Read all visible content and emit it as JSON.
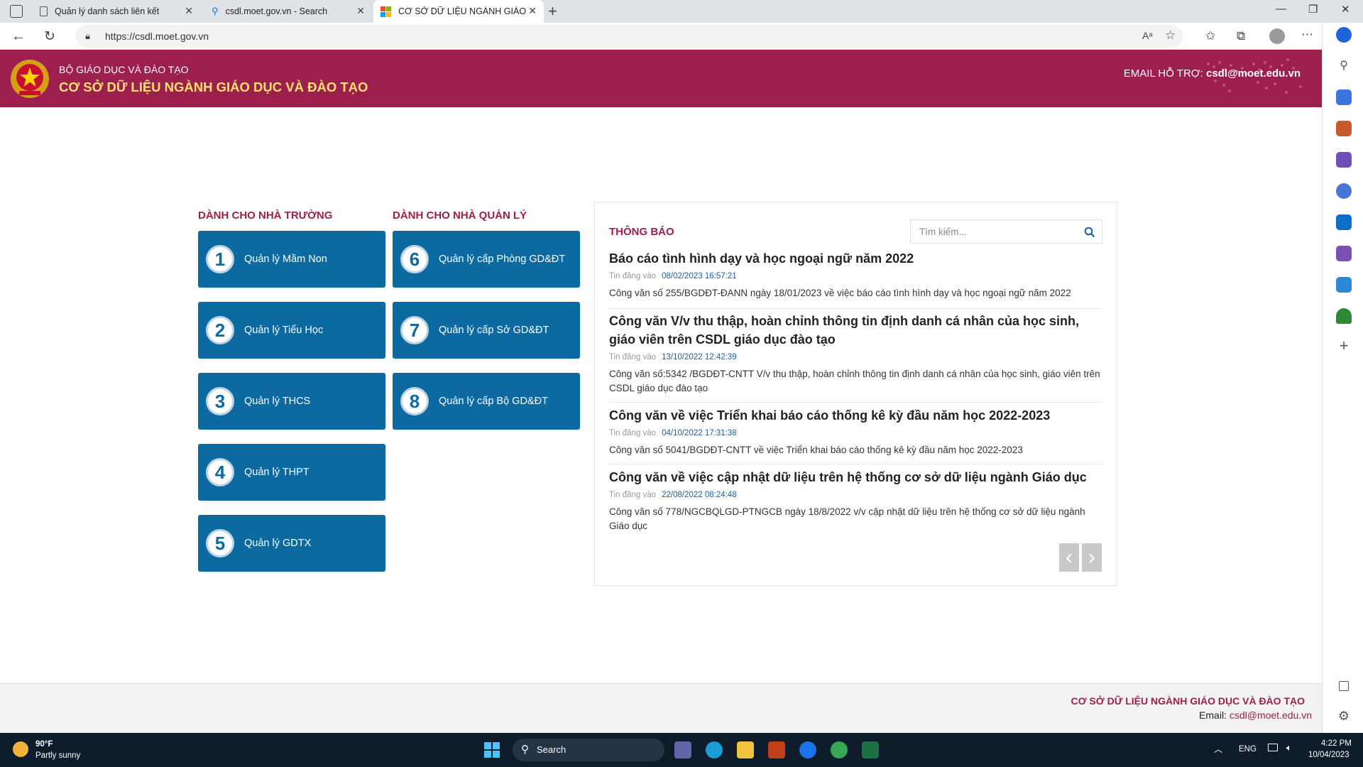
{
  "browser": {
    "tabs": [
      {
        "title": "Quản lý danh sách liên kết"
      },
      {
        "title": "csdl.moet.gov.vn - Search"
      },
      {
        "title": "CƠ SỞ DỮ LIỆU NGÀNH GIÁO DỤ"
      }
    ],
    "url": "https://csdl.moet.gov.vn"
  },
  "header": {
    "org": "BỘ GIÁO DỤC VÀ ĐÀO TẠO",
    "site_title": "CƠ SỞ DỮ LIỆU NGÀNH GIÁO DỤC VÀ ĐÀO TẠO",
    "email_label": "EMAIL HỖ TRỢ:",
    "email_value": "csdl@moet.edu.vn"
  },
  "schools": {
    "heading": "DÀNH CHO NHÀ TRƯỜNG",
    "items": [
      {
        "num": "1",
        "label": "Quản lý Mầm Non"
      },
      {
        "num": "2",
        "label": "Quản lý Tiểu Học"
      },
      {
        "num": "3",
        "label": "Quản lý THCS"
      },
      {
        "num": "4",
        "label": "Quản lý THPT"
      },
      {
        "num": "5",
        "label": "Quản lý GDTX"
      }
    ]
  },
  "managers": {
    "heading": "DÀNH CHO NHÀ QUẢN LÝ",
    "items": [
      {
        "num": "6",
        "label": "Quản lý cấp Phòng GD&ĐT"
      },
      {
        "num": "7",
        "label": "Quản lý cấp Sở GD&ĐT"
      },
      {
        "num": "8",
        "label": "Quản lý cấp Bộ GD&ĐT"
      }
    ]
  },
  "notices": {
    "heading": "THÔNG BÁO",
    "search_placeholder": "Tìm kiếm...",
    "posted_label": "Tin đăng vào",
    "items": [
      {
        "title": "Báo cáo tình hình dạy và học ngoại ngữ năm 2022",
        "date": "08/02/2023 16:57:21",
        "desc": "Công văn số 255/BGDĐT-ĐANN ngày 18/01/2023 về việc báo cáo tình hình dạy và học ngoại ngữ năm 2022"
      },
      {
        "title": "Công văn V/v thu thập, hoàn chỉnh thông tin định danh cá nhân của học sinh, giáo viên trên CSDL giáo dục đào tạo",
        "date": "13/10/2022 12:42:39",
        "desc": "Công văn số:5342 /BGDĐT-CNTT V/v thu thập, hoàn chỉnh thông tin định danh cá nhân của học sinh, giáo viên trên CSDL giáo dục đào tạo"
      },
      {
        "title": "Công văn về việc Triển khai báo cáo thống kê kỳ đầu năm học 2022-2023",
        "date": "04/10/2022 17:31:38",
        "desc": "Công văn số 5041/BGDĐT-CNTT về việc Triển khai báo cáo thống kê kỳ đầu năm học 2022-2023"
      },
      {
        "title": "Công văn về việc cập nhật dữ liệu trên hệ thống cơ sở dữ liệu ngành Giáo dục",
        "date": "22/08/2022 08:24:48",
        "desc": "Công văn số 778/NGCBQLGD-PTNGCB ngày 18/8/2022 v/v cập nhật dữ liệu trên hệ thống cơ sở dữ liệu ngành Giáo dục"
      }
    ]
  },
  "footer": {
    "title": "CƠ SỞ DỮ LIỆU NGÀNH GIÁO DỤC VÀ ĐÀO TẠO",
    "email_label": "Email:",
    "email_value": "csdl@moet.edu.vn"
  },
  "taskbar": {
    "weather_temp": "90°F",
    "weather_desc": "Partly sunny",
    "search_label": "Search",
    "lang": "ENG",
    "time": "4:22 PM",
    "date": "10/04/2023"
  },
  "colors": {
    "brand": "#9c1f4d",
    "button": "#0c6aa0",
    "header_title": "#ffe070"
  }
}
